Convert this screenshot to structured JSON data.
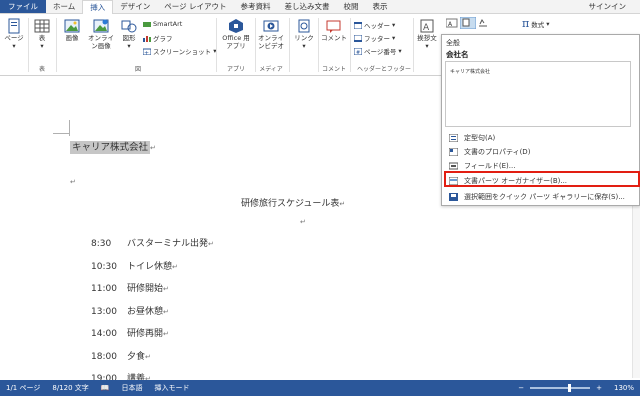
{
  "tabs": [
    "ファイル",
    "ホーム",
    "挿入",
    "デザイン",
    "ページ レイアウト",
    "参考資料",
    "差し込み文書",
    "校閲",
    "表示"
  ],
  "signin": "サインイン",
  "ribbon": {
    "page": "ページ",
    "table": "表",
    "picture": "画像",
    "online_picture": "オンライン画像",
    "shapes": "図形",
    "smartart": "SmartArt",
    "graph": "グラフ",
    "screenshot": "スクリーンショット",
    "office_app": "Office 用アプリ",
    "online_video": "オンラインビデオ",
    "link": "リンク",
    "comment": "コメント",
    "header": "ヘッダー",
    "footer": "フッター",
    "page_number": "ページ番号",
    "textbox": "挨拶文",
    "equation": "数式",
    "groups": {
      "table": "表",
      "figure": "図",
      "app": "アプリ",
      "media": "メディア",
      "comment": "コメント",
      "header_footer": "ヘッダーとフッター"
    }
  },
  "document": {
    "company": "キャリア株式会社",
    "title": "研修旅行スケジュール表",
    "schedule": [
      {
        "time": "8:30",
        "event": "バスターミナル出発"
      },
      {
        "time": "10:30",
        "event": "トイレ休憩"
      },
      {
        "time": "11:00",
        "event": "研修開始"
      },
      {
        "time": "13:00",
        "event": "お昼休憩"
      },
      {
        "time": "14:00",
        "event": "研修再開"
      },
      {
        "time": "18:00",
        "event": "夕食"
      },
      {
        "time": "19:00",
        "event": "講義"
      }
    ]
  },
  "dropdown": {
    "header": "全般",
    "label": "会社名",
    "preview_text": "キャリア株式会社",
    "items": [
      "定型句(A)",
      "文書のプロパティ(D)",
      "フィールド(E)...",
      "文書パーツ オーガナイザー(B)...",
      "選択範囲をクイック パーツ ギャラリーに保存(S)..."
    ]
  },
  "status": {
    "page": "1/1 ページ",
    "words": "8/120 文字",
    "lang": "日本語",
    "mode": "挿入モード",
    "zoom": "130%"
  },
  "colors": {
    "accent": "#2b579a",
    "highlight": "#e21e12"
  }
}
